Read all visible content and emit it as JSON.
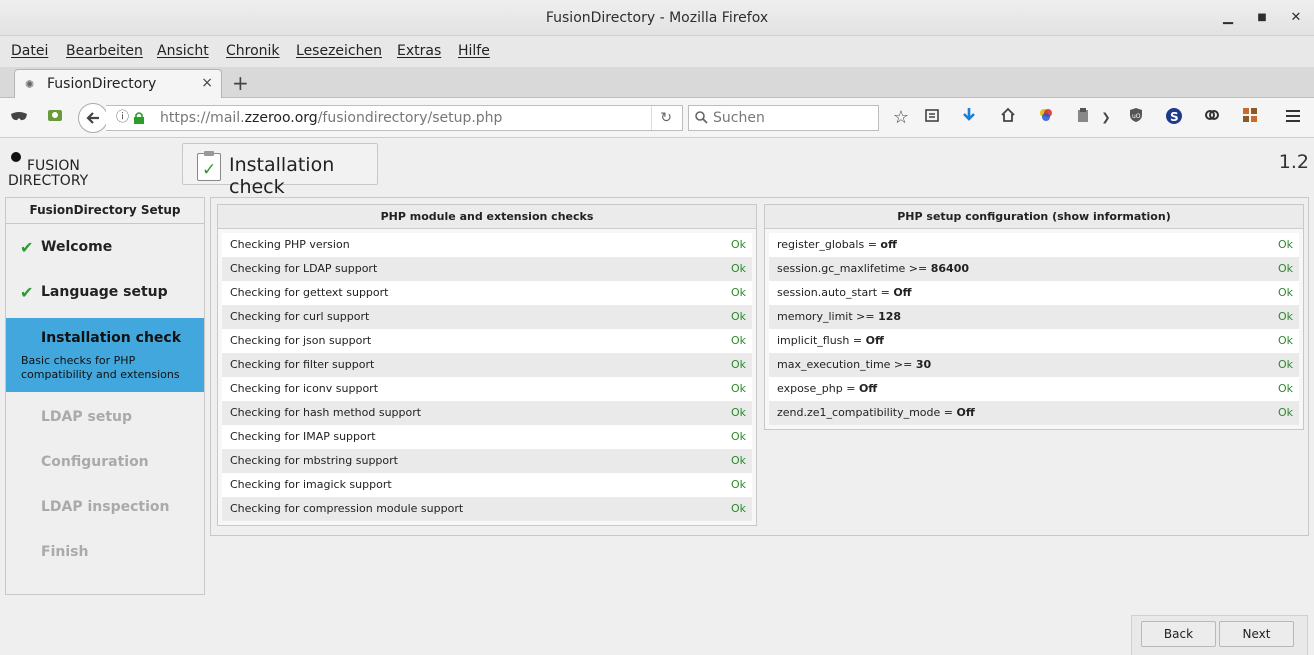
{
  "window": {
    "title": "FusionDirectory - Mozilla Firefox",
    "minimize": "▁",
    "maximize": "■",
    "close": "✕"
  },
  "menu": [
    "Datei",
    "Bearbeiten",
    "Ansicht",
    "Chronik",
    "Lesezeichen",
    "Extras",
    "Hilfe"
  ],
  "tab": {
    "title": "FusionDirectory",
    "close": "×",
    "new": "+"
  },
  "navbar": {
    "url_prefix": "https://mail.",
    "url_domain": "zzeroo.org",
    "url_path": "/fusiondirectory/setup.php",
    "search_placeholder": "Suchen",
    "icons": [
      "mask-icon",
      "extension-icon",
      "back-icon",
      "info-icon",
      "lock-icon",
      "reload-icon",
      "search-icon",
      "star-icon",
      "reading-list-icon",
      "download-icon",
      "home-icon",
      "colors-icon",
      "clipboard-icon",
      "dropdown-icon",
      "ublock-icon",
      "s-icon",
      "chain-icon",
      "grid-icon",
      "menu-icon"
    ]
  },
  "logo": {
    "line1": "FUSION",
    "line2": "DIRECTORY"
  },
  "page": {
    "title": "Installation check",
    "version": "1.2"
  },
  "sidebar": {
    "header": "FusionDirectory Setup",
    "steps": [
      {
        "label": "Welcome",
        "state": "done"
      },
      {
        "label": "Language setup",
        "state": "done"
      },
      {
        "label": "Installation check",
        "state": "active",
        "description": "Basic checks for PHP compatibility and extensions"
      },
      {
        "label": "LDAP setup",
        "state": "todo"
      },
      {
        "label": "Configuration",
        "state": "todo"
      },
      {
        "label": "LDAP inspection",
        "state": "todo"
      },
      {
        "label": "Finish",
        "state": "todo"
      }
    ]
  },
  "checks": {
    "title": "PHP module and extension checks",
    "rows": [
      {
        "label": "Checking PHP version",
        "status": "Ok"
      },
      {
        "label": "Checking for LDAP support",
        "status": "Ok"
      },
      {
        "label": "Checking for gettext support",
        "status": "Ok"
      },
      {
        "label": "Checking for curl support",
        "status": "Ok"
      },
      {
        "label": "Checking for json support",
        "status": "Ok"
      },
      {
        "label": "Checking for filter support",
        "status": "Ok"
      },
      {
        "label": "Checking for iconv support",
        "status": "Ok"
      },
      {
        "label": "Checking for hash method support",
        "status": "Ok"
      },
      {
        "label": "Checking for IMAP support",
        "status": "Ok"
      },
      {
        "label": "Checking for mbstring support",
        "status": "Ok"
      },
      {
        "label": "Checking for imagick support",
        "status": "Ok"
      },
      {
        "label": "Checking for compression module support",
        "status": "Ok"
      }
    ]
  },
  "config": {
    "title": "PHP setup configuration (show information)",
    "rows": [
      {
        "key": "register_globals = ",
        "value": "off",
        "status": "Ok"
      },
      {
        "key": "session.gc_maxlifetime >= ",
        "value": "86400",
        "status": "Ok"
      },
      {
        "key": "session.auto_start = ",
        "value": "Off",
        "status": "Ok"
      },
      {
        "key": "memory_limit >= ",
        "value": "128",
        "status": "Ok"
      },
      {
        "key": "implicit_flush = ",
        "value": "Off",
        "status": "Ok"
      },
      {
        "key": "max_execution_time >= ",
        "value": "30",
        "status": "Ok"
      },
      {
        "key": "expose_php = ",
        "value": "Off",
        "status": "Ok"
      },
      {
        "key": "zend.ze1_compatibility_mode = ",
        "value": "Off",
        "status": "Ok"
      }
    ]
  },
  "buttons": {
    "back": "Back",
    "next": "Next"
  },
  "colors": {
    "accent": "#41a7dd",
    "ok": "#2a8a2a"
  }
}
